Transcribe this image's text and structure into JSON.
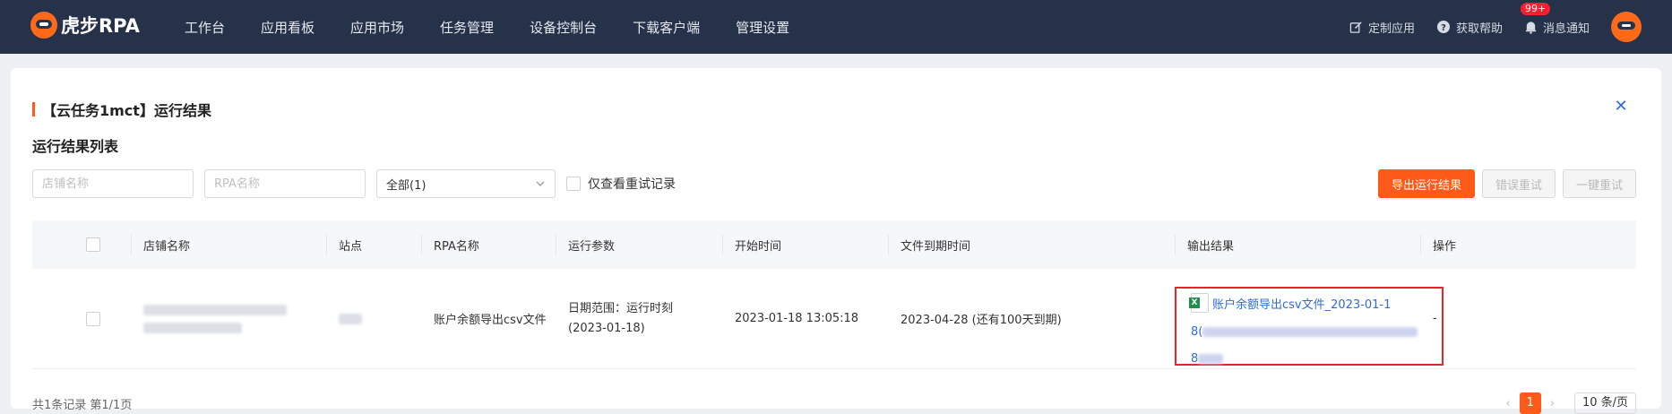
{
  "header": {
    "logo": "虎步RPA",
    "nav": [
      "工作台",
      "应用看板",
      "应用市场",
      "任务管理",
      "设备控制台",
      "下载客户端",
      "管理设置"
    ],
    "custom_app": "定制应用",
    "help": "获取帮助",
    "notify": "消息通知",
    "notify_badge": "99+"
  },
  "page": {
    "title": "【云任务1mct】运行结果",
    "subtitle": "运行结果列表"
  },
  "filters": {
    "shop_placeholder": "店铺名称",
    "rpa_placeholder": "RPA名称",
    "status_value": "全部(1)",
    "retry_only": "仅查看重试记录"
  },
  "actions": {
    "export": "导出运行结果",
    "error_retry": "错误重试",
    "one_click_retry": "一键重试"
  },
  "table": {
    "headers": [
      "店铺名称",
      "站点",
      "RPA名称",
      "运行参数",
      "开始时间",
      "文件到期时间",
      "输出结果",
      "操作"
    ],
    "rows": [
      {
        "rpa_name": "账户余额导出csv文件",
        "params_line1": "日期范围：运行时刻",
        "params_line2": "(2023-01-18)",
        "start_time": "2023-01-18 13:05:18",
        "expire_time": "2023-04-28 (还有100天到期)",
        "result_line1": "账户余额导出csv文件_2023-01-1",
        "result_line2": "8(",
        "result_line3": "8",
        "op": "-"
      }
    ]
  },
  "footer": {
    "summary": "共1条记录 第1/1页",
    "current_page": "1",
    "page_size": "10 条/页"
  }
}
